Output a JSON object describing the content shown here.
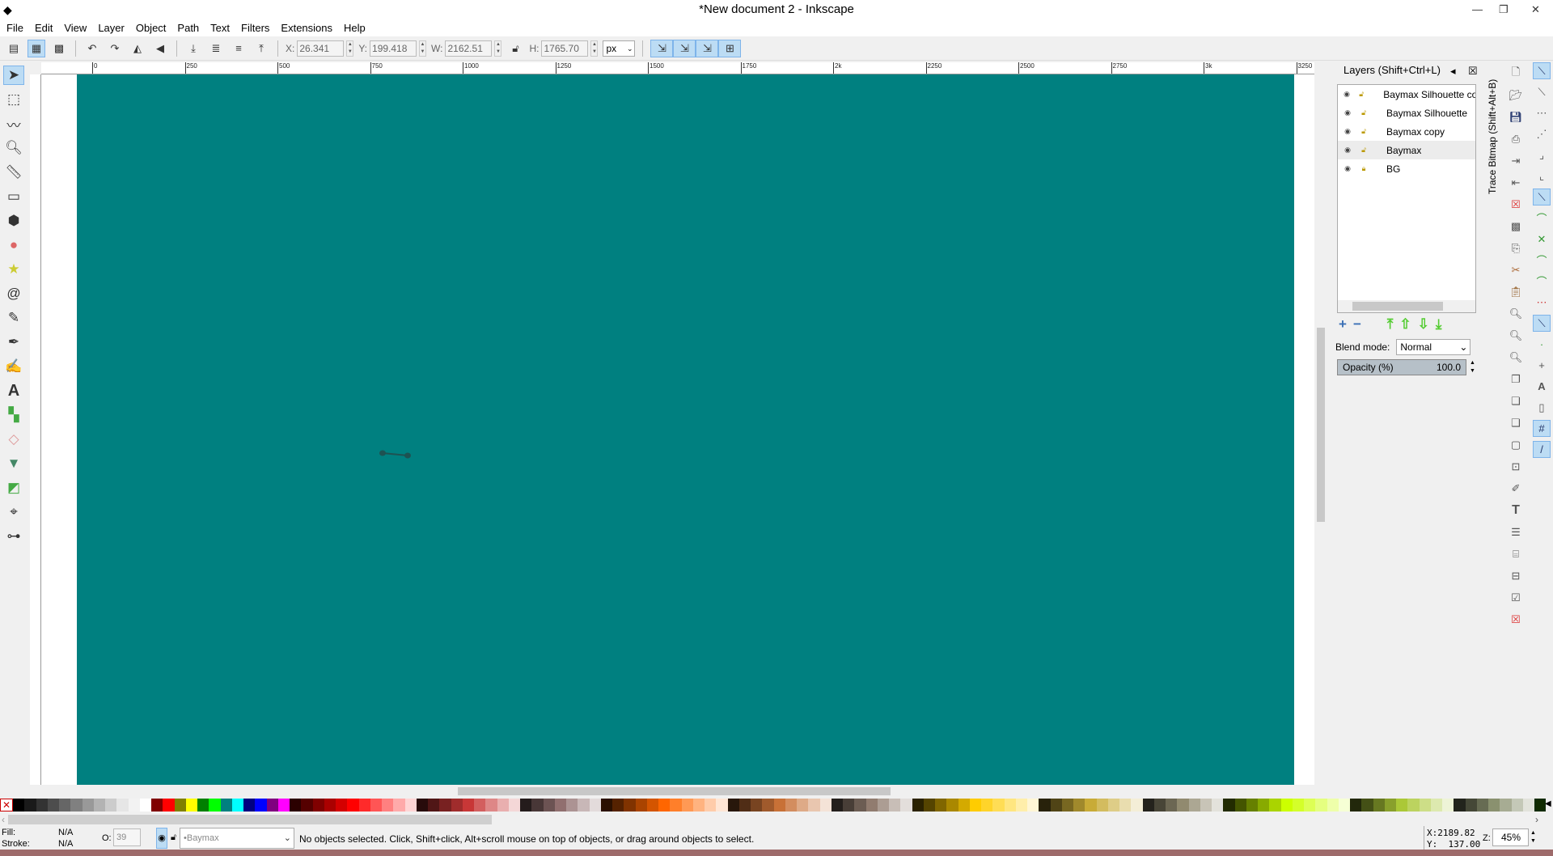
{
  "window": {
    "title": "*New document 2 - Inkscape",
    "minimize": "—",
    "restore": "❐",
    "close": "✕"
  },
  "menu": [
    "File",
    "Edit",
    "View",
    "Layer",
    "Object",
    "Path",
    "Text",
    "Filters",
    "Extensions",
    "Help"
  ],
  "toolbar": {
    "x_label": "X:",
    "x": "26.341",
    "y_label": "Y:",
    "y": "199.418",
    "w_label": "W:",
    "w": "2162.51",
    "h_label": "H:",
    "h": "1765.70",
    "unit": "px"
  },
  "ruler": {
    "labels": [
      "0",
      "250",
      "500",
      "750",
      "1000",
      "1250",
      "1500",
      "1750",
      "2k",
      "2250",
      "2500",
      "2750",
      "3k",
      "3250"
    ]
  },
  "canvas": {
    "page_color": "#008080",
    "object_color": "#1e5252"
  },
  "layers": {
    "title": "Layers (Shift+Ctrl+L)",
    "items": [
      {
        "name": "Baymax Silhouette copy",
        "selected": false,
        "locked": false
      },
      {
        "name": "Baymax Silhouette",
        "selected": false,
        "locked": false
      },
      {
        "name": "Baymax copy",
        "selected": false,
        "locked": false
      },
      {
        "name": "Baymax",
        "selected": true,
        "locked": false
      },
      {
        "name": "BG",
        "selected": false,
        "locked": true
      }
    ],
    "blend_label": "Blend mode:",
    "blend_value": "Normal",
    "opacity_label": "Opacity (%)",
    "opacity_value": "100.0"
  },
  "trace_tab": "Trace Bitmap (Shift+Alt+B)",
  "palette": [
    "#000000",
    "#1a1a1a",
    "#333333",
    "#4d4d4d",
    "#666666",
    "#808080",
    "#999999",
    "#b3b3b3",
    "#cccccc",
    "#e6e6e6",
    "#f2f2f2",
    "#ffffff",
    "#800000",
    "#ff0000",
    "#808000",
    "#ffff00",
    "#008000",
    "#00ff00",
    "#008080",
    "#00ffff",
    "#000080",
    "#0000ff",
    "#800080",
    "#ff00ff",
    "#2b0000",
    "#550000",
    "#800000",
    "#aa0000",
    "#d40000",
    "#ff0000",
    "#ff2a2a",
    "#ff5555",
    "#ff8080",
    "#ffaaaa",
    "#ffd5d5",
    "#280b0b",
    "#501616",
    "#782121",
    "#a02c2c",
    "#c83737",
    "#d35f5f",
    "#de8787",
    "#e9afaf",
    "#f4d7d7",
    "#241c1c",
    "#483737",
    "#6c5353",
    "#916f6f",
    "#ac9393",
    "#c8b7b7",
    "#e3dbdb",
    "#2b1100",
    "#552200",
    "#803300",
    "#aa4400",
    "#d45500",
    "#ff6600",
    "#ff7f2a",
    "#ff9955",
    "#ffb380",
    "#ffccaa",
    "#ffe6d5",
    "#28170b",
    "#502d16",
    "#784421",
    "#a05a2c",
    "#c87137",
    "#d38d5f",
    "#deaa87",
    "#e9c6af",
    "#f4e3d7",
    "#241f1c",
    "#483e37",
    "#6c5d53",
    "#917c6f",
    "#ac9d93",
    "#c8beb7",
    "#e3dedb",
    "#2b2200",
    "#554400",
    "#806600",
    "#aa8800",
    "#d4aa00",
    "#ffcc00",
    "#ffd42a",
    "#ffdd55",
    "#ffe680",
    "#ffeeaa",
    "#fff6d5",
    "#28220b",
    "#504416",
    "#786721",
    "#a0892c",
    "#c8ab37",
    "#d3bc5f",
    "#decd87",
    "#e9ddaf",
    "#f4eed7",
    "#24221c",
    "#484537",
    "#6c6753",
    "#918a6f",
    "#aca793",
    "#c8c4b7",
    "#e3e2db",
    "#222b00",
    "#445500",
    "#668000",
    "#88aa00",
    "#aad400",
    "#ccff00",
    "#d4ff2a",
    "#ddff55",
    "#e5ff80",
    "#eeffaa",
    "#f6ffd5",
    "#22280b",
    "#445016",
    "#677821",
    "#89a02c",
    "#abc837",
    "#bcd35f",
    "#cdde87",
    "#dde9af",
    "#eef4d7",
    "#22241c",
    "#454837",
    "#676c53",
    "#8a916f",
    "#a7ac93",
    "#c4c8b7",
    "#e2e3db",
    "#112b00"
  ],
  "status": {
    "fill_label": "Fill:",
    "fill": "N/A",
    "stroke_label": "Stroke:",
    "stroke": "N/A",
    "o_label": "O:",
    "o_value": "39",
    "layer": "•Baymax",
    "message": "No objects selected. Click, Shift+click, Alt+scroll mouse on top of objects, or drag around objects to select.",
    "cx_label": "X:",
    "cx": "2189.82",
    "cy_label": "Y:",
    "cy": "137.00",
    "zoom_label": "Z:",
    "zoom": "45%"
  }
}
